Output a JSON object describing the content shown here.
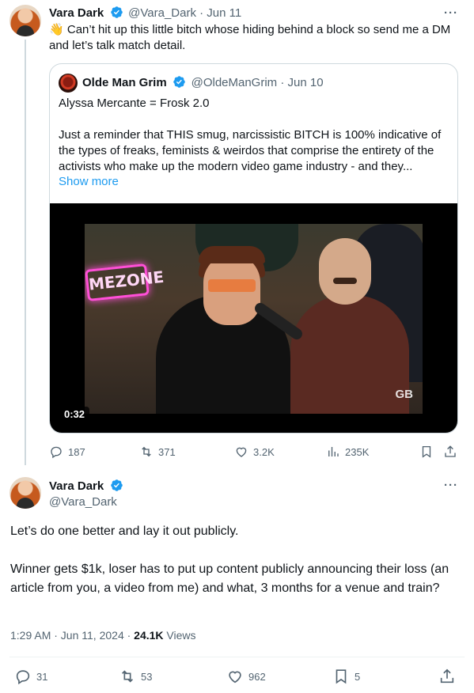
{
  "tweet1": {
    "author_name": "Vara Dark",
    "handle_time": "@Vara_Dark · Jun 11",
    "emoji": "👋",
    "text": "Can’t hit up this little bitch whose hiding behind a block so send me a DM and let’s talk match detail.",
    "more": "···",
    "quote": {
      "author_name": "Olde Man Grim",
      "handle_time": "@OldeManGrim · Jun 10",
      "line1": "Alyssa Mercante = Frosk 2.0",
      "body": "Just a reminder that THIS smug, narcissistic BITCH is 100% indicative of the types of freaks, feminists & weirdos that comprise the entirety of the activists who make up the modern video game industry - and they...",
      "show_more": "Show more",
      "video": {
        "duration": "0:32",
        "neon_sign": "MEZONE",
        "watermark": "GB"
      }
    },
    "actions": {
      "replies": "187",
      "reposts": "371",
      "likes": "3.2K",
      "views": "235K"
    }
  },
  "tweet2": {
    "author_name": "Vara Dark",
    "handle": "@Vara_Dark",
    "more": "···",
    "para1": "Let’s do one better and lay it out publicly.",
    "para2": "Winner gets $1k, loser has to put up content publicly announcing their loss (an article from you, a video from me) and what, 3 months for a venue and train?",
    "time_date": "1:29 AM · Jun 11, 2024 · ",
    "views_count": "24.1K",
    "views_label": " Views",
    "actions": {
      "replies": "31",
      "reposts": "53",
      "likes": "962",
      "bookmarks": "5"
    }
  },
  "colors": {
    "accent": "#1d9bf0",
    "muted": "#536471",
    "text": "#0f1419",
    "border": "#cfd9de"
  },
  "icons": [
    "verified-badge-icon",
    "reply-icon",
    "repost-icon",
    "like-icon",
    "views-icon",
    "bookmark-icon",
    "share-icon",
    "more-icon"
  ]
}
